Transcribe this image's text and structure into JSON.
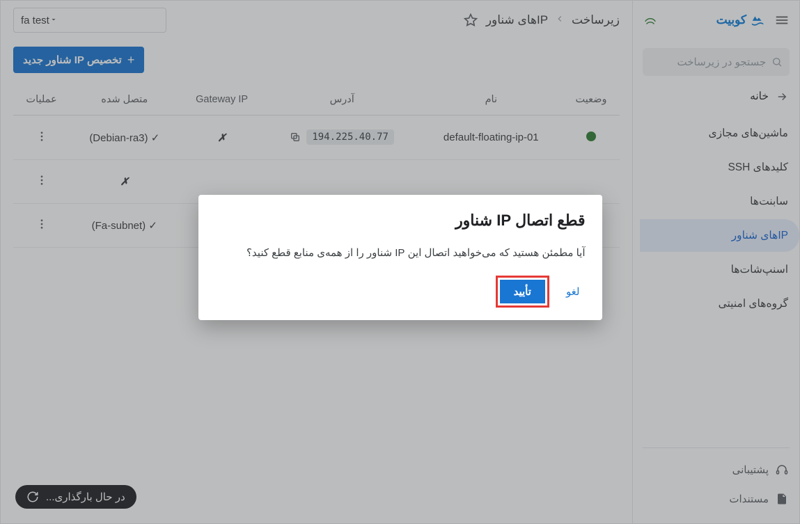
{
  "brand": {
    "name": "کوبیت"
  },
  "search": {
    "placeholder": "جستجو در زیرساخت"
  },
  "nav": {
    "home": "خانه",
    "items": [
      {
        "label": "ماشین‌های مجازی"
      },
      {
        "label": "کلیدهای SSH"
      },
      {
        "label": "سابنت‌ها"
      },
      {
        "label": "IPهای شناور",
        "active": true
      },
      {
        "label": "اسنپ‌شات‌ها"
      },
      {
        "label": "گروه‌های امنیتی"
      }
    ],
    "support": "پشتیبانی",
    "docs": "مستندات"
  },
  "breadcrumb": {
    "root": "زیرساخت",
    "current": "IPهای شناور"
  },
  "project_select": {
    "value": "fa test"
  },
  "toolbar": {
    "new_floating_ip": "تخصیص IP شناور جدید"
  },
  "table": {
    "headers": {
      "status": "وضعیت",
      "name": "نام",
      "address": "آدرس",
      "gateway": "Gateway IP",
      "attached": "متصل شده",
      "actions": "عملیات"
    },
    "rows": [
      {
        "status": "green",
        "name": "default-floating-ip-01",
        "address": "194.225.40.77",
        "gateway": "✗",
        "attached": "(Debian-ra3)",
        "attached_check": "✓"
      },
      {
        "status": "",
        "name": "",
        "address": "",
        "gateway": "",
        "attached": "✗",
        "attached_check": ""
      },
      {
        "status": "",
        "name": "",
        "address": "",
        "gateway": "",
        "attached": "(Fa-subnet)",
        "attached_check": "✓"
      }
    ]
  },
  "loading": {
    "text": "در حال بارگذاری..."
  },
  "modal": {
    "title": "قطع اتصال IP شناور",
    "message": "آیا مطمئن هستید که می‌خواهید اتصال این IP شناور را از همه‌ی منابع قطع کنید؟",
    "confirm": "تأیید",
    "cancel": "لغو"
  }
}
